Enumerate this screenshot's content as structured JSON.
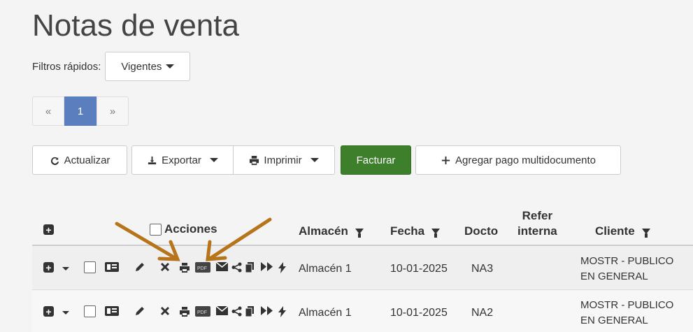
{
  "page": {
    "title": "Notas de venta"
  },
  "quick_filters": {
    "label": "Filtros rápidos:",
    "selected": "Vigentes"
  },
  "pagination": {
    "prev": "«",
    "current": "1",
    "next": "»"
  },
  "toolbar": {
    "refresh": "Actualizar",
    "export": "Exportar",
    "print": "Imprimir",
    "invoice": "Facturar",
    "add_payment": "Agregar pago multidocumento"
  },
  "table": {
    "headers": {
      "actions": "Acciones",
      "warehouse": "Almacén",
      "date": "Fecha",
      "doc": "Docto",
      "ref_line1": "Refer",
      "ref_line2": "interna",
      "client": "Cliente"
    },
    "rows": [
      {
        "warehouse": "Almacén 1",
        "date": "10-01-2025",
        "doc": "NA3",
        "ref": "",
        "client_line1": "MOSTR - PUBLICO",
        "client_line2": "EN GENERAL"
      },
      {
        "warehouse": "Almacén 1",
        "date": "10-01-2025",
        "doc": "NA2",
        "ref": "",
        "client_line1": "MOSTR - PUBLICO",
        "client_line2": "EN GENERAL"
      }
    ],
    "action_icons": [
      "expand-icon",
      "caret-icon",
      "checkbox",
      "id-card-icon",
      "pencil-icon",
      "cancel-icon",
      "print-icon",
      "pdf-icon",
      "email-icon",
      "share-icon",
      "copy-icon",
      "forward-icon",
      "bolt-icon"
    ]
  },
  "colors": {
    "invoice_button": "#3e7f2c",
    "active_page": "#5b7fbe",
    "annotation_arrow": "#b8741a"
  }
}
